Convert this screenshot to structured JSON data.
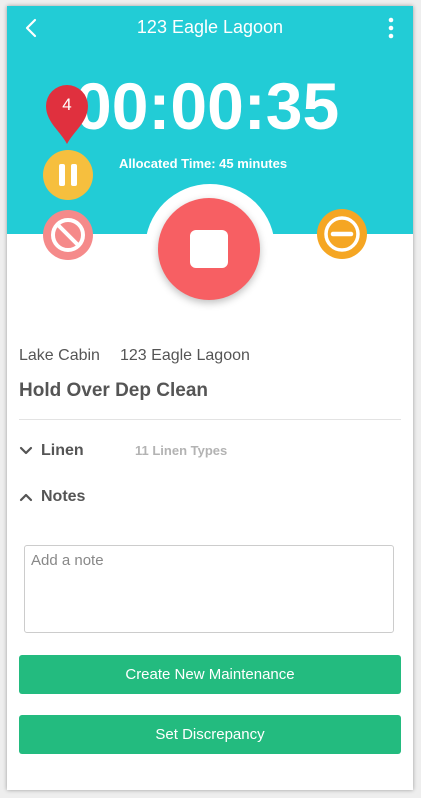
{
  "header": {
    "title": "123 Eagle Lagoon",
    "back_icon": "chevron-left-icon",
    "menu_icon": "more-vertical-icon"
  },
  "timer": {
    "elapsed": "00:00:35",
    "allocated_label": "Allocated Time: 45 minutes"
  },
  "badge": {
    "count": "4"
  },
  "controls": {
    "pause_icon": "pause-icon",
    "cancel_icon": "block-icon",
    "stop_icon": "stop-icon",
    "minus_icon": "minus-icon"
  },
  "location": {
    "type": "Lake Cabin",
    "address": "123 Eagle Lagoon"
  },
  "task": {
    "name": "Hold Over Dep Clean"
  },
  "sections": {
    "linen": {
      "label": "Linen",
      "summary": "11 Linen Types",
      "icon": "chevron-down-icon"
    },
    "notes": {
      "label": "Notes",
      "icon": "chevron-up-icon"
    }
  },
  "note": {
    "placeholder": "Add a note",
    "value": ""
  },
  "buttons": {
    "create_maintenance": "Create New Maintenance",
    "set_discrepancy": "Set Discrepancy"
  },
  "colors": {
    "header_bg": "#22ccd6",
    "pause": "#f6bf3e",
    "cancel": "#f58a8a",
    "stop": "#f75f63",
    "minus": "#f5a623",
    "badge": "#e0303e",
    "action": "#23bb7f"
  }
}
